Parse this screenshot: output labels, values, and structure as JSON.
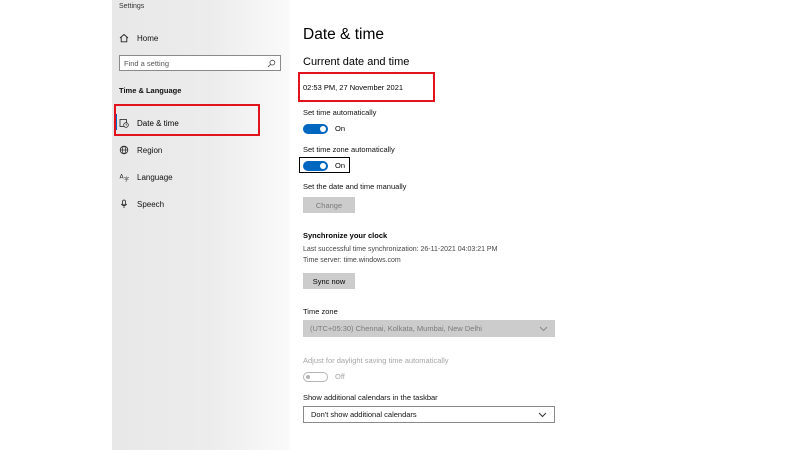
{
  "window": {
    "title": "Settings"
  },
  "sidebar": {
    "home_label": "Home",
    "search_placeholder": "Find a setting",
    "section": "Time & Language",
    "items": [
      {
        "label": "Date & time",
        "icon": "clock-calendar-icon",
        "selected": true
      },
      {
        "label": "Region",
        "icon": "globe-icon"
      },
      {
        "label": "Language",
        "icon": "language-icon"
      },
      {
        "label": "Speech",
        "icon": "microphone-icon"
      }
    ]
  },
  "main": {
    "title": "Date & time",
    "current_heading": "Current date and time",
    "current_value": "02:53 PM, 27 November 2021",
    "auto_time": {
      "label": "Set time automatically",
      "state": "On"
    },
    "auto_zone": {
      "label": "Set time zone automatically",
      "state": "On"
    },
    "manual": {
      "label": "Set the date and time manually",
      "button": "Change"
    },
    "sync": {
      "heading": "Synchronize your clock",
      "last": "Last successful time synchronization: 26-11-2021 04:03:21 PM",
      "server": "Time server: time.windows.com",
      "button": "Sync now"
    },
    "timezone": {
      "label": "Time zone",
      "value": "(UTC+05:30) Chennai, Kolkata, Mumbai, New Delhi"
    },
    "dst": {
      "label": "Adjust for daylight saving time automatically",
      "state": "Off"
    },
    "calendars": {
      "label": "Show additional calendars in the taskbar",
      "value": "Don't show additional calendars"
    }
  },
  "colors": {
    "accent": "#0067c0",
    "highlight": "#e1141e"
  }
}
